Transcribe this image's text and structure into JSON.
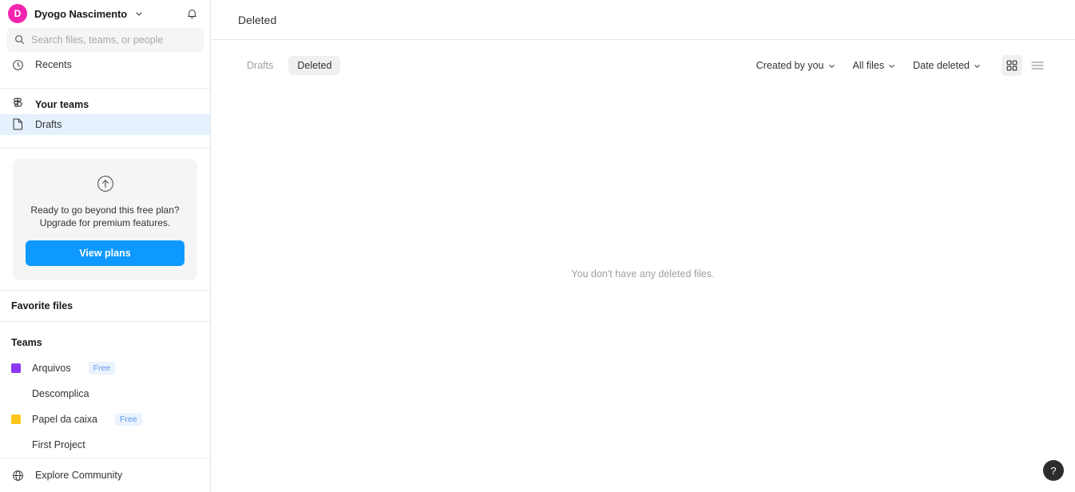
{
  "sidebar": {
    "user": {
      "avatar_initial": "D",
      "name": "Dyogo Nascimento",
      "avatar_color": "#f524b0"
    },
    "notifications_icon": "bell-icon",
    "search": {
      "placeholder": "Search files, teams, or people",
      "value": ""
    },
    "recents_label": "Recents",
    "your_teams_label": "Your teams",
    "drafts_label": "Drafts",
    "upgrade": {
      "line1": "Ready to go beyond this free plan?",
      "line2": "Upgrade for premium features.",
      "button_label": "View plans",
      "button_color": "#0d99ff"
    },
    "favorite_files_label": "Favorite files",
    "teams_label": "Teams",
    "teams": [
      {
        "name": "Arquivos",
        "color": "#8a38f5",
        "badge": "Free"
      },
      {
        "name": "Descomplica",
        "color": "",
        "badge": ""
      },
      {
        "name": "Papel da caixa",
        "color": "#ffc61a",
        "badge": "Free"
      },
      {
        "name": "First Project",
        "color": "",
        "badge": ""
      }
    ],
    "explore_community_label": "Explore Community"
  },
  "main": {
    "page_title": "Deleted",
    "tabs": [
      {
        "label": "Drafts",
        "active": false
      },
      {
        "label": "Deleted",
        "active": true
      }
    ],
    "filters": [
      {
        "label": "Created by you"
      },
      {
        "label": "All files"
      },
      {
        "label": "Date deleted"
      }
    ],
    "views": [
      {
        "name": "grid-view",
        "active": true
      },
      {
        "name": "list-view",
        "active": false
      }
    ],
    "empty_message": "You don't have any deleted files.",
    "help_label": "?"
  }
}
